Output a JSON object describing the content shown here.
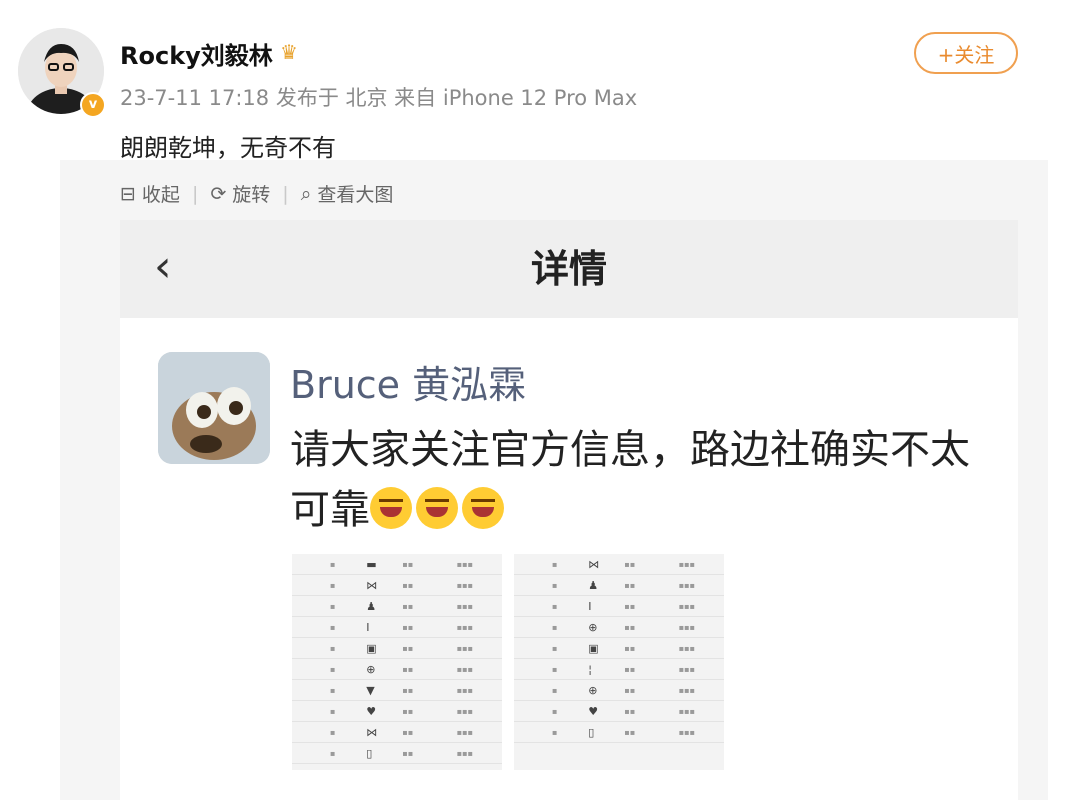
{
  "post": {
    "username": "Rocky刘毅林",
    "meta": "23-7-11 17:18 发布于 北京 来自 iPhone 12 Pro Max",
    "follow_label": "+关注",
    "text": "朗朗乾坤，无奇不有"
  },
  "toolbar": {
    "collapse": "收起",
    "rotate": "旋转",
    "view_large": "查看大图"
  },
  "screenshot": {
    "nav_title": "详情",
    "author": "Bruce 黄泓霖",
    "text": "请大家关注官方信息，路边社确实不太可靠",
    "emoji_count": 3
  },
  "colors": {
    "accent": "#e98b2f",
    "verified": "#f4a621",
    "link_name": "#55607a"
  }
}
